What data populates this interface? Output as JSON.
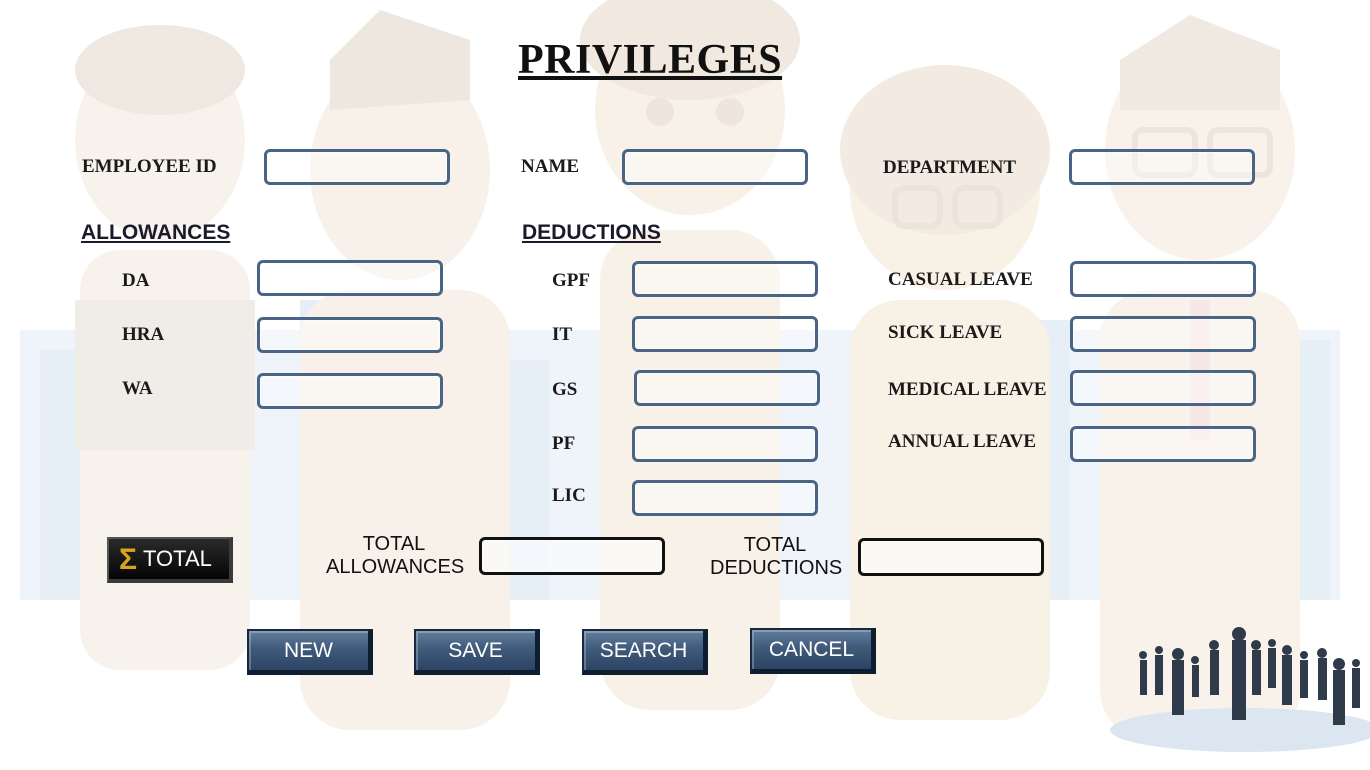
{
  "title": "PRIVILEGES",
  "header_fields": {
    "employee_id": {
      "label": "EMPLOYEE ID",
      "value": ""
    },
    "name": {
      "label": "NAME",
      "value": ""
    },
    "department": {
      "label": "DEPARTMENT",
      "value": ""
    }
  },
  "allowances": {
    "heading": "ALLOWANCES",
    "items": [
      {
        "label": "DA",
        "value": ""
      },
      {
        "label": "HRA",
        "value": ""
      },
      {
        "label": "WA",
        "value": ""
      }
    ]
  },
  "deductions": {
    "heading": "DEDUCTIONS",
    "items": [
      {
        "label": "GPF",
        "value": ""
      },
      {
        "label": "IT",
        "value": ""
      },
      {
        "label": "GS",
        "value": ""
      },
      {
        "label": "PF",
        "value": ""
      },
      {
        "label": "LIC",
        "value": ""
      }
    ]
  },
  "leaves": {
    "items": [
      {
        "label": "CASUAL LEAVE",
        "value": ""
      },
      {
        "label": "SICK LEAVE",
        "value": ""
      },
      {
        "label": "MEDICAL LEAVE",
        "value": ""
      },
      {
        "label": "ANNUAL LEAVE",
        "value": ""
      }
    ]
  },
  "totals": {
    "button_symbol": "Σ",
    "button_label": "TOTAL",
    "total_allowances_line1": "TOTAL",
    "total_allowances_line2": "ALLOWANCES",
    "total_allowances_value": "",
    "total_deductions_line1": "TOTAL",
    "total_deductions_line2": "DEDUCTIONS",
    "total_deductions_value": ""
  },
  "actions": {
    "new": "NEW",
    "save": "SAVE",
    "search": "SEARCH",
    "cancel": "CANCEL"
  },
  "colors": {
    "field_border": "#4a6486",
    "button_blue": "#3f5a7a",
    "total_button": "#0a0a0a",
    "sigma": "#d8a520"
  }
}
